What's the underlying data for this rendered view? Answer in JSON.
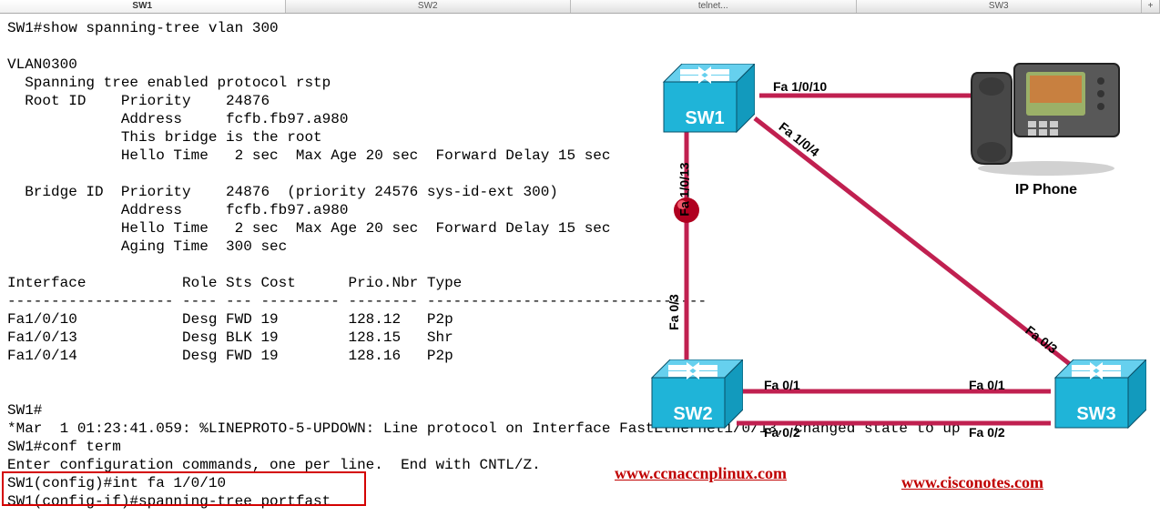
{
  "tabs": {
    "t1": "SW1",
    "t2": "SW2",
    "t3": "telnet...",
    "t4": "SW3",
    "add": "+"
  },
  "terminal": {
    "l1": "SW1#show spanning-tree vlan 300",
    "l2": "",
    "l3": "VLAN0300",
    "l4": "  Spanning tree enabled protocol rstp",
    "l5": "  Root ID    Priority    24876",
    "l6": "             Address     fcfb.fb97.a980",
    "l7": "             This bridge is the root",
    "l8": "             Hello Time   2 sec  Max Age 20 sec  Forward Delay 15 sec",
    "l9": "",
    "l10": "  Bridge ID  Priority    24876  (priority 24576 sys-id-ext 300)",
    "l11": "             Address     fcfb.fb97.a980",
    "l12": "             Hello Time   2 sec  Max Age 20 sec  Forward Delay 15 sec",
    "l13": "             Aging Time  300 sec",
    "l14": "",
    "l15": "Interface           Role Sts Cost      Prio.Nbr Type",
    "l16": "------------------- ---- --- --------- -------- --------------------------------",
    "l17": "Fa1/0/10            Desg FWD 19        128.12   P2p",
    "l18": "Fa1/0/13            Desg BLK 19        128.15   Shr",
    "l19": "Fa1/0/14            Desg FWD 19        128.16   P2p",
    "l20": "",
    "l21": "",
    "l22": "SW1#",
    "l23": "*Mar  1 01:23:41.059: %LINEPROTO-5-UPDOWN: Line protocol on Interface FastEthernet1/0/13, changed state to up",
    "l24": "SW1#conf term",
    "l25": "Enter configuration commands, one per line.  End with CNTL/Z.",
    "l26": "SW1(config)#int fa 1/0/10",
    "l27": "SW1(config-if)#spanning-tree portfast"
  },
  "diagram": {
    "sw1": "SW1",
    "sw2": "SW2",
    "sw3": "SW3",
    "phone": "IP Phone",
    "links": {
      "fa1010": "Fa 1/0/10",
      "fa104": "Fa 1/0/4",
      "fa1013": "Fa 1/0/13",
      "fa03_a": "Fa 0/3",
      "fa03_b": "Fa 0/3",
      "fa01_a": "Fa 0/1",
      "fa01_b": "Fa 0/1",
      "fa02_a": "Fa 0/2",
      "fa02_b": "Fa 0/2"
    }
  },
  "urls": {
    "u1": "www.ccnaccnplinux.com",
    "u2": "www.cisconotes.com"
  }
}
